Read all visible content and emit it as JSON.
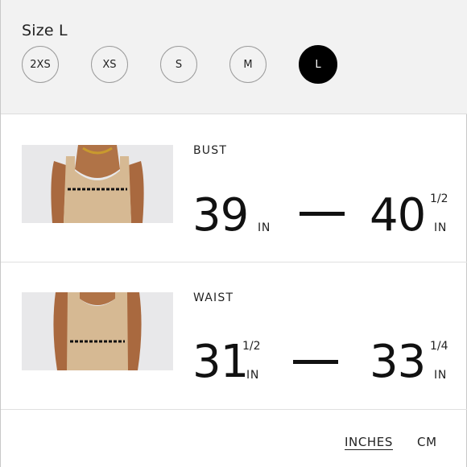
{
  "size_selector": {
    "title": "Size L",
    "options": [
      "2XS",
      "XS",
      "S",
      "M",
      "L"
    ],
    "selected": "L"
  },
  "measurements": [
    {
      "label": "BUST",
      "from": {
        "whole": "39",
        "fraction": "",
        "unit": "IN"
      },
      "to": {
        "whole": "40",
        "fraction": "1/2",
        "unit": "IN"
      }
    },
    {
      "label": "WAIST",
      "from": {
        "whole": "31",
        "fraction": "1/2",
        "unit": "IN"
      },
      "to": {
        "whole": "33",
        "fraction": "1/4",
        "unit": "IN"
      }
    }
  ],
  "units": {
    "inches_label": "INCHES",
    "cm_label": "CM",
    "active": "INCHES"
  },
  "colors": {
    "panel_bg": "#f2f2f2",
    "selected_bg": "#000000",
    "garment": "#d6b993",
    "skin": "#a9693f"
  }
}
